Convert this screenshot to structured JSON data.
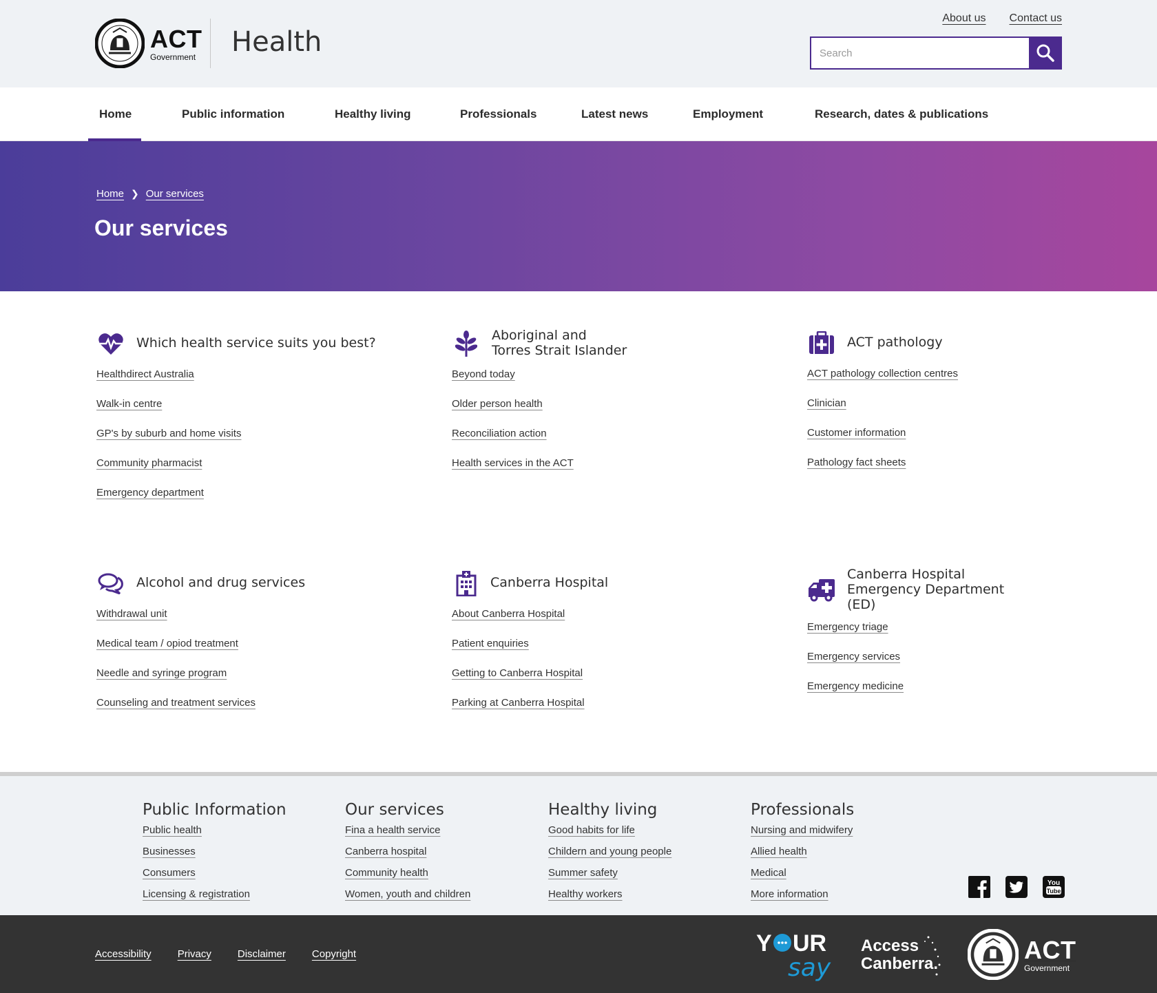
{
  "header": {
    "logo_act": "ACT",
    "logo_gov": "Government",
    "site_name": "Health",
    "util_links": [
      "About us",
      "Contact us"
    ],
    "search": {
      "placeholder": "Search",
      "value": ""
    }
  },
  "nav": {
    "items": [
      "Home",
      "Public information",
      "Healthy living",
      "Professionals",
      "Latest news",
      "Employment",
      "Research, dates & publications"
    ],
    "active": "Home"
  },
  "hero": {
    "breadcrumb": [
      "Home",
      "Our services"
    ],
    "title": "Our services"
  },
  "services": [
    {
      "title": "Which health service suits you best?",
      "icon": "heartbeat-icon",
      "links": [
        "Healthdirect Australia",
        "Walk-in centre",
        "GP's by suburb and home visits",
        "Community pharmacist",
        "Emergency department"
      ]
    },
    {
      "title": "Aboriginal and Torres Strait Islander",
      "icon": "leaf-plant-icon",
      "links": [
        "Beyond today",
        "Older person health",
        "Reconciliation action",
        "Health services in the ACT"
      ]
    },
    {
      "title": "ACT pathology",
      "icon": "first-aid-kit-icon",
      "links": [
        "ACT pathology collection centres",
        "Clinician",
        "Customer information",
        "Pathology fact sheets"
      ]
    },
    {
      "title": "Alcohol and drug services",
      "icon": "chat-bubbles-icon",
      "links": [
        "Withdrawal unit",
        "Medical team / opiod treatment",
        "Needle and syringe program",
        "Counseling and treatment services"
      ]
    },
    {
      "title": "Canberra Hospital",
      "icon": "hospital-building-icon",
      "links": [
        "About Canberra Hospital",
        "Patient enquiries",
        "Getting to Canberra Hospital",
        "Parking at Canberra Hospital"
      ]
    },
    {
      "title": "Canberra Hospital Emergency Department (ED)",
      "icon": "ambulance-icon",
      "links": [
        "Emergency triage",
        "Emergency services",
        "Emergency medicine"
      ]
    }
  ],
  "footer": {
    "columns": [
      {
        "title": "Public Information",
        "links": [
          "Public health",
          "Businesses",
          "Consumers",
          "Licensing & registration"
        ]
      },
      {
        "title": "Our services",
        "links": [
          "Fina a health service",
          "Canberra hospital",
          "Community health",
          "Women, youth and children"
        ]
      },
      {
        "title": "Healthy living",
        "links": [
          "Good habits for life",
          "Childern and young people",
          "Summer safety",
          "Healthy workers"
        ]
      },
      {
        "title": "Professionals",
        "links": [
          "Nursing and midwifery",
          "Allied health",
          "Medical",
          "More information"
        ]
      }
    ],
    "social": [
      "facebook-icon",
      "twitter-icon",
      "youtube-icon"
    ],
    "youtube_text": [
      "You",
      "Tube"
    ],
    "legal": [
      "Accessibility",
      "Privacy",
      "Disclaimer",
      "Copyright"
    ],
    "partners": {
      "yoursay": [
        "Y",
        "UR",
        "say"
      ],
      "access_canberra": [
        "Access",
        "Canberra."
      ],
      "act": {
        "act": "ACT",
        "gov": "Government"
      }
    }
  },
  "colors": {
    "brand_purple": "#4b2a8e",
    "header_bg": "#eff2f5",
    "footer_dark": "#333333"
  }
}
